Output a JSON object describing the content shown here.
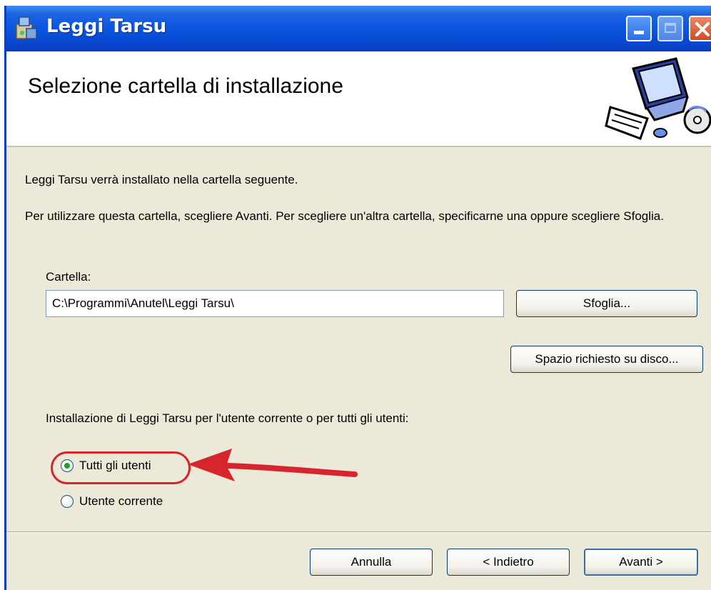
{
  "window": {
    "title": "Leggi Tarsu"
  },
  "banner": {
    "title": "Selezione cartella di installazione"
  },
  "body": {
    "intro": "Leggi Tarsu verrà installato nella cartella seguente.",
    "instructions": "Per utilizzare questa cartella, scegliere Avanti. Per scegliere un'altra cartella, specificarne una oppure scegliere Sfoglia.",
    "folder_label": "Cartella:",
    "folder_value": "C:\\Programmi\\Anutel\\Leggi Tarsu\\",
    "browse_label": "Sfoglia...",
    "disk_space_label": "Spazio richiesto su disco...",
    "scope_label": "Installazione di Leggi Tarsu per l'utente corrente o per tutti gli utenti:",
    "radio_all_users": "Tutti gli utenti",
    "radio_current_user": "Utente corrente",
    "selected_option": "Tutti gli utenti"
  },
  "footer": {
    "cancel_label": "Annulla",
    "back_label": "< Indietro",
    "next_label": "Avanti >"
  },
  "colors": {
    "titlebar": "#0a55e0",
    "dialog_bg": "#ece9d8",
    "annotation": "#d6252c"
  }
}
